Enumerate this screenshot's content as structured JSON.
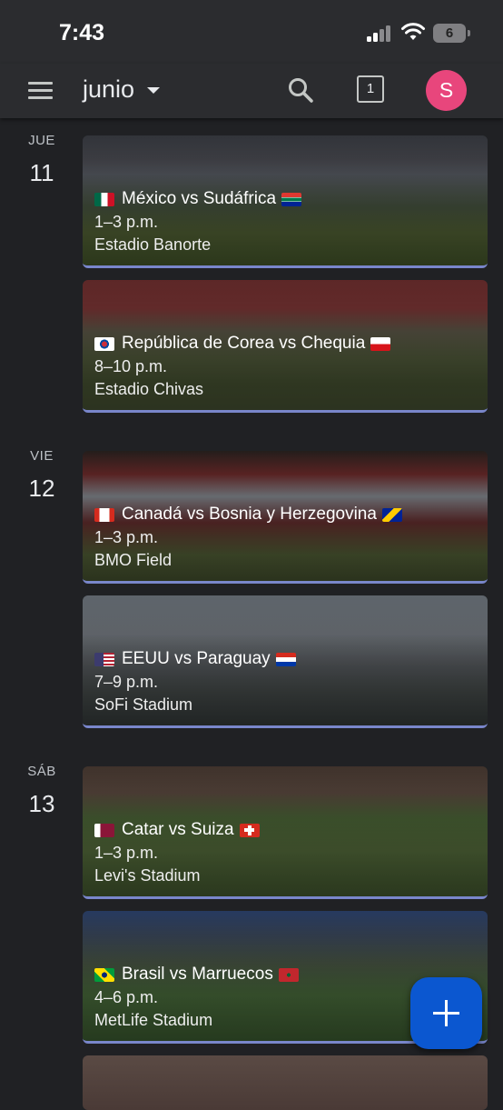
{
  "status_bar": {
    "time": "7:43",
    "battery": "6"
  },
  "header": {
    "month": "junio",
    "today": "1",
    "avatar_initial": "S"
  },
  "days": [
    {
      "dow": "JUE",
      "num": "11"
    },
    {
      "dow": "VIE",
      "num": "12"
    },
    {
      "dow": "SÁB",
      "num": "13"
    }
  ],
  "events": [
    {
      "title": "México vs Sudáfrica",
      "time": "1–3 p.m.",
      "place": "Estadio Banorte",
      "flag_left": "mexico-flag",
      "flag_right": "south-africa-flag"
    },
    {
      "title": "República de Corea vs Chequia",
      "time": "8–10 p.m.",
      "place": "Estadio Chivas",
      "flag_left": "korea-flag",
      "flag_right": "czechia-flag"
    },
    {
      "title": "Canadá vs Bosnia y Herzegovina",
      "time": "1–3 p.m.",
      "place": "BMO Field",
      "flag_left": "canada-flag",
      "flag_right": "bosnia-flag"
    },
    {
      "title": "EEUU vs Paraguay",
      "time": "7–9 p.m.",
      "place": "SoFi Stadium",
      "flag_left": "usa-flag",
      "flag_right": "paraguay-flag"
    },
    {
      "title": "Catar vs Suiza",
      "time": "1–3 p.m.",
      "place": "Levi's Stadium",
      "flag_left": "qatar-flag",
      "flag_right": "switzerland-flag"
    },
    {
      "title": "Brasil vs Marruecos",
      "time": "4–6 p.m.",
      "place": "MetLife Stadium",
      "flag_left": "brazil-flag",
      "flag_right": "morocco-flag"
    }
  ],
  "colors": {
    "background": "#202124",
    "event_accent": "#7986cb",
    "fab": "#0b57d0",
    "avatar": "#e8467c"
  }
}
